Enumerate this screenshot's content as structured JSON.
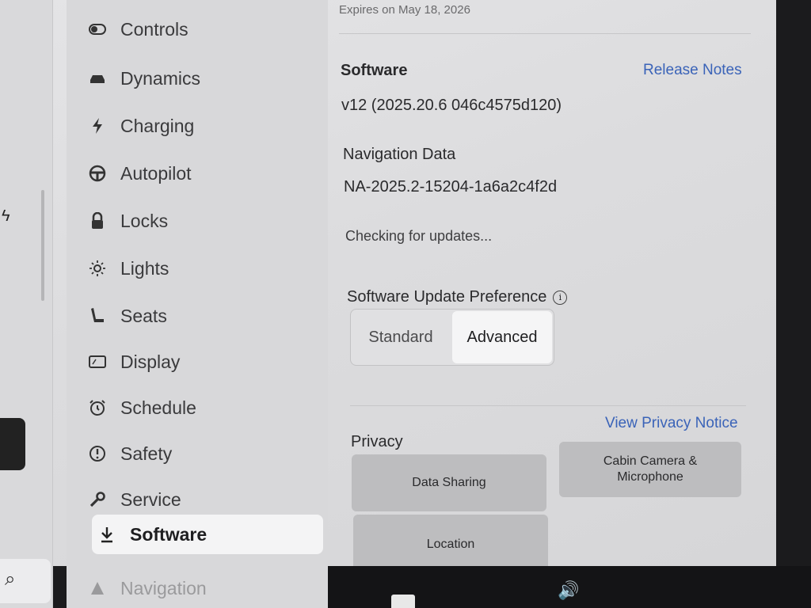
{
  "sidebar": {
    "items": [
      {
        "label": "Controls",
        "icon": "toggle-icon",
        "glyph": "⬭"
      },
      {
        "label": "Dynamics",
        "icon": "car-icon",
        "glyph": "🚘"
      },
      {
        "label": "Charging",
        "icon": "bolt-icon",
        "glyph": "ϟ"
      },
      {
        "label": "Autopilot",
        "icon": "steering-wheel-icon",
        "glyph": "⊜"
      },
      {
        "label": "Locks",
        "icon": "lock-icon",
        "glyph": "🔒"
      },
      {
        "label": "Lights",
        "icon": "sun-icon",
        "glyph": "☼"
      },
      {
        "label": "Seats",
        "icon": "seat-icon",
        "glyph": "⌊"
      },
      {
        "label": "Display",
        "icon": "display-icon",
        "glyph": "▭"
      },
      {
        "label": "Schedule",
        "icon": "alarm-clock-icon",
        "glyph": "⏰"
      },
      {
        "label": "Safety",
        "icon": "alert-circle-icon",
        "glyph": "ⓘ"
      },
      {
        "label": "Service",
        "icon": "wrench-icon",
        "glyph": "🔧"
      },
      {
        "label": "Software",
        "icon": "download-icon",
        "glyph": "⤓"
      },
      {
        "label": "Navigation",
        "icon": "navigation-icon",
        "glyph": "▲"
      }
    ],
    "active": "Software"
  },
  "main": {
    "expires_text": "Expires on May 18, 2026",
    "software_label": "Software",
    "release_notes_link": "Release Notes",
    "software_version": "v12 (2025.20.6 046c4575d120)",
    "nav_data_label": "Navigation Data",
    "nav_data_value": "NA-2025.2-15204-1a6a2c4f2d",
    "status_text": "Checking for updates...",
    "update_pref_label": "Software Update Preference",
    "update_pref_options": [
      "Standard",
      "Advanced"
    ],
    "update_pref_selected": "Advanced",
    "privacy_label": "Privacy",
    "privacy_notice_link": "View Privacy Notice",
    "privacy_buttons": {
      "data_sharing": "Data Sharing",
      "cabin_camera_line1": "Cabin Camera &",
      "cabin_camera_line2": "Microphone",
      "location": "Location"
    }
  },
  "colors": {
    "accent_link": "#3a63b8",
    "active_bg": "#f4f4f5"
  }
}
